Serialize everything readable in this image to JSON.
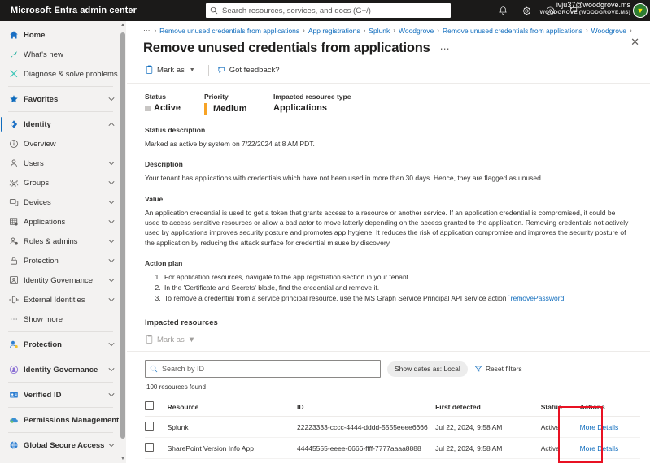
{
  "topbar": {
    "brand": "Microsoft Entra admin center",
    "search_placeholder": "Search resources, services, and docs (G+/)",
    "icons": [
      {
        "name": "notifications-icon",
        "glyph": "bell"
      },
      {
        "name": "settings-gear-icon",
        "glyph": "gear"
      },
      {
        "name": "help-question-icon",
        "glyph": "question"
      },
      {
        "name": "feedback-icon",
        "glyph": "feedback"
      }
    ],
    "account_email": "ivju37@woodgrove.ms",
    "account_tenant": "WOODGROVE (WOODGROVE.MS)",
    "avatar_initial": "▼"
  },
  "sidebar": {
    "items": [
      {
        "label": "Home",
        "icon": "home-icon",
        "bold": true,
        "chevron": false,
        "selected": false,
        "sep_after": false
      },
      {
        "label": "What's new",
        "icon": "whats-new-icon",
        "bold": false,
        "chevron": false,
        "selected": false,
        "sep_after": false
      },
      {
        "label": "Diagnose & solve problems",
        "icon": "diagnose-icon",
        "bold": false,
        "chevron": false,
        "selected": false,
        "sep_after": true
      },
      {
        "label": "Favorites",
        "icon": "star-icon",
        "bold": true,
        "chevron": true,
        "selected": false,
        "sep_after": true
      },
      {
        "label": "Identity",
        "icon": "identity-icon",
        "bold": true,
        "chevron": true,
        "selected": true,
        "sep_after": false,
        "expanded": true
      },
      {
        "label": "Overview",
        "icon": "overview-info-icon",
        "bold": false,
        "chevron": false,
        "selected": false,
        "sep_after": false
      },
      {
        "label": "Users",
        "icon": "users-icon",
        "bold": false,
        "chevron": true,
        "selected": false,
        "sep_after": false
      },
      {
        "label": "Groups",
        "icon": "groups-icon",
        "bold": false,
        "chevron": true,
        "selected": false,
        "sep_after": false
      },
      {
        "label": "Devices",
        "icon": "devices-icon",
        "bold": false,
        "chevron": true,
        "selected": false,
        "sep_after": false
      },
      {
        "label": "Applications",
        "icon": "applications-icon",
        "bold": false,
        "chevron": true,
        "selected": false,
        "sep_after": false
      },
      {
        "label": "Roles & admins",
        "icon": "roles-admins-icon",
        "bold": false,
        "chevron": true,
        "selected": false,
        "sep_after": false
      },
      {
        "label": "Protection",
        "icon": "lock-icon",
        "bold": false,
        "chevron": true,
        "selected": false,
        "sep_after": false
      },
      {
        "label": "Identity Governance",
        "icon": "governance-icon",
        "bold": false,
        "chevron": true,
        "selected": false,
        "sep_after": false
      },
      {
        "label": "External Identities",
        "icon": "external-identities-icon",
        "bold": false,
        "chevron": true,
        "selected": false,
        "sep_after": false
      },
      {
        "label": "Show more",
        "icon": "ellipsis-icon",
        "bold": false,
        "chevron": false,
        "selected": false,
        "sep_after": true
      },
      {
        "label": "Protection",
        "icon": "protection-person-icon",
        "bold": true,
        "chevron": true,
        "selected": false,
        "sep_after": true
      },
      {
        "label": "Identity Governance",
        "icon": "identity-governance-icon",
        "bold": true,
        "chevron": true,
        "selected": false,
        "sep_after": true
      },
      {
        "label": "Verified ID",
        "icon": "verified-id-icon",
        "bold": true,
        "chevron": true,
        "selected": false,
        "sep_after": true
      },
      {
        "label": "Permissions Management",
        "icon": "permissions-cloud-icon",
        "bold": true,
        "chevron": false,
        "selected": false,
        "sep_after": true
      },
      {
        "label": "Global Secure Access",
        "icon": "global-secure-access-icon",
        "bold": true,
        "chevron": true,
        "selected": false,
        "sep_after": false
      }
    ]
  },
  "breadcrumb": {
    "leading_dots": "⋯",
    "items": [
      "Remove unused credentials from applications",
      "App registrations",
      "Splunk",
      "Woodgrove",
      "Remove unused credentials from applications",
      "Woodgrove"
    ],
    "separator": "›"
  },
  "page": {
    "title": "Remove unused credentials from applications",
    "ellipsis": "⋯",
    "close": "✕"
  },
  "commandbar": {
    "mark_as": "Mark as",
    "got_feedback": "Got feedback?"
  },
  "meta": {
    "status_label": "Status",
    "status_value": "Active",
    "priority_label": "Priority",
    "priority_value": "Medium",
    "priority_color": "#f7a325",
    "resource_type_label": "Impacted resource type",
    "resource_type_value": "Applications"
  },
  "sections": {
    "status_description_heading": "Status description",
    "status_description_text": "Marked as active by system on 7/22/2024 at 8 AM PDT.",
    "description_heading": "Description",
    "description_text": "Your tenant has applications with credentials which have not been used in more than 30 days. Hence, they are flagged as unused.",
    "value_heading": "Value",
    "value_text": "An application credential is used to get a token that grants access to a resource or another service. If an application credential is compromised, it could be used to access sensitive resources or allow a bad actor to move latterly depending on the access granted to the application. Removing credentials not actively used by applications improves security posture and promotes app hygiene. It reduces the risk of application compromise and improves the security posture of the application by reducing the attack surface for credential misuse by discovery.",
    "action_plan_heading": "Action plan",
    "action_plan_steps": [
      "For application resources, navigate to the app registration section in your tenant.",
      "In the 'Certificate and Secrets' blade, find the credential and remove it.",
      "To remove a credential from a service principal resource, use the MS Graph Service Principal API service action "
    ],
    "action_plan_step3_code": "`removePassword`"
  },
  "impacted": {
    "heading": "Impacted resources",
    "mark_as": "Mark as",
    "search_placeholder": "Search by ID",
    "show_dates_pill": "Show dates as: Local",
    "reset_filters": "Reset filters",
    "count_text": "100 resources found",
    "columns": [
      "Resource",
      "ID",
      "First detected",
      "Status",
      "Actions"
    ],
    "rows": [
      {
        "resource": "Splunk",
        "id": "22223333-cccc-4444-dddd-5555eeee6666",
        "first_detected": "Jul 22, 2024, 9:58 AM",
        "status": "Active",
        "action": "More Details"
      },
      {
        "resource": "SharePoint Version Info App",
        "id": "44445555-eeee-6666-ffff-7777aaaa8888",
        "first_detected": "Jul 22, 2024, 9:58 AM",
        "status": "Active",
        "action": "More Details"
      }
    ]
  },
  "annotation": {
    "color": "#e81123",
    "target": "actions-column"
  }
}
